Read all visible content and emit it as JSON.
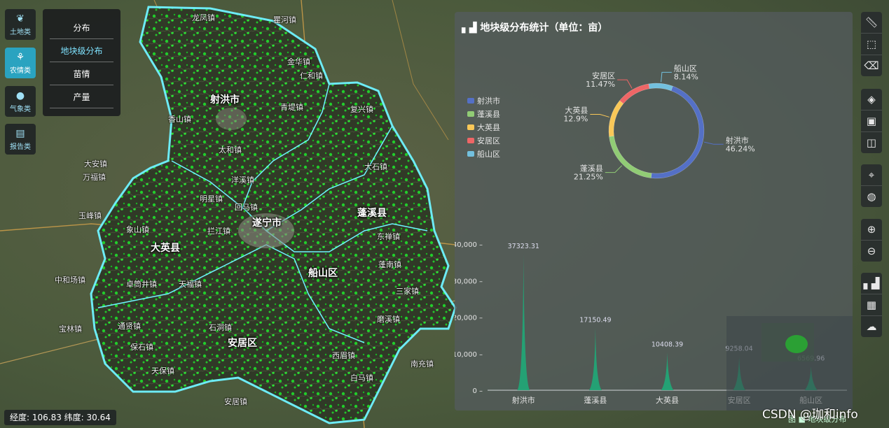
{
  "map": {
    "regions": [
      "射洪市",
      "遂宁市",
      "蓬溪县",
      "大英县",
      "船山区",
      "安居区"
    ],
    "towns": [
      "龙凤镇",
      "瞿河镇",
      "金华镇",
      "青堤镇",
      "复兴镇",
      "仁和镇",
      "香山镇",
      "明星镇",
      "太和镇",
      "洋溪镇",
      "天福镇",
      "蓬南镇",
      "大石镇",
      "回马镇",
      "象山镇",
      "拦江镇",
      "中和场镇",
      "玉峰镇",
      "石洞镇",
      "保石镇",
      "西眉镇",
      "东禅镇",
      "三家镇",
      "磨溪镇",
      "白马镇",
      "通贤镇",
      "天保镇",
      "卓筒井镇",
      "南充镇",
      "宝林镇",
      "安居镇",
      "大安镇",
      "万福镇"
    ]
  },
  "categories": [
    {
      "label": "土地类",
      "icon": "leaf-icon",
      "active": false
    },
    {
      "label": "农情类",
      "icon": "wheat-icon",
      "active": true
    },
    {
      "label": "气象类",
      "icon": "drop-icon",
      "active": false
    },
    {
      "label": "报告类",
      "icon": "report-icon",
      "active": false
    }
  ],
  "submenu": [
    {
      "label": "分布",
      "active": false
    },
    {
      "label": "地块级分布",
      "active": true
    },
    {
      "label": "苗情",
      "active": false
    },
    {
      "label": "产量",
      "active": false
    }
  ],
  "coords": {
    "text": "经度: 106.83 纬度: 30.64"
  },
  "panel": {
    "title": "地块级分布统计（单位：亩）",
    "title_icon": "bar-chart-icon"
  },
  "chart_data": [
    {
      "type": "pie",
      "style": "donut",
      "legend_position": "left",
      "labels": [
        "射洪市",
        "蓬溪县",
        "大英县",
        "安居区",
        "船山区"
      ],
      "values": [
        46.24,
        21.25,
        12.9,
        11.47,
        8.14
      ],
      "value_labels": [
        "46.24%",
        "21.25%",
        "12.9%",
        "11.47%",
        "8.14%"
      ],
      "colors": [
        "#5470c6",
        "#91cc75",
        "#fac858",
        "#ee6666",
        "#73c0de"
      ]
    },
    {
      "type": "area",
      "style": "pictorial-peak",
      "categories": [
        "射洪市",
        "蓬溪县",
        "大英县",
        "安居区",
        "船山区"
      ],
      "values": [
        37323.31,
        17150.49,
        10408.39,
        9258.04,
        6569.96
      ],
      "value_labels": [
        "37323.31",
        "17150.49",
        "10408.39",
        "9258.04",
        "6569.96"
      ],
      "ylim": [
        0,
        40000
      ],
      "yticks": [
        "0",
        "10,000",
        "20,000",
        "30,000",
        "40,000"
      ],
      "color": "#1fa878"
    }
  ],
  "toolbar": {
    "groups": [
      [
        "ruler-icon",
        "area-measure-icon",
        "clear-icon"
      ],
      [
        "layers-icon",
        "image-icon",
        "split-icon"
      ],
      [
        "locate-icon",
        "globe-icon"
      ],
      [
        "zoom-in-icon",
        "zoom-out-icon"
      ],
      [
        "stats-icon",
        "table-icon",
        "download-icon"
      ]
    ]
  },
  "watermark": "CSDN @珈和info",
  "minimap_legend": "图 ■ 地块级分布"
}
